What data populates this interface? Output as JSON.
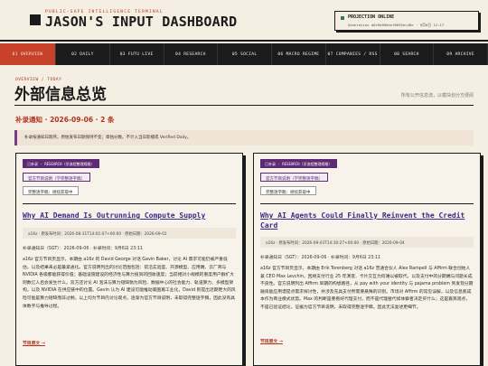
{
  "header": {
    "kicker": "PUBLIC-SAFE INTELLIGENCE TERMINAL",
    "title": "JASON'S INPUT DASHBOARD",
    "projection": {
      "title": "PROJECTION ONLINE",
      "meta": "Generation d0c9e000eef8695ec48e · 9月6日 12:17"
    }
  },
  "nav": [
    "01 OVERVIEW",
    "02 DAILY",
    "03 FUTU LIVE",
    "04 RESEARCH",
    "05 SOCIAL",
    "06 MACRO REGIME",
    "07 COMPANIES / RSS",
    "08 SEARCH",
    "09 ARCHIVE"
  ],
  "page": {
    "crumb": "OVERVIEW / TODAY",
    "title": "外部信息总览",
    "subtitle": "所有公开信息流，以模块划分方便阅"
  },
  "section": {
    "title": "补录通知 · 2026-09-06 · 2 条",
    "notice": "补录按通知日期序。原始发布日期保持不变；章独分数。不计入当日影播或 Verified Daily。"
  },
  "cards": [
    {
      "tag": "已补录 · RESEARCH（学流程整理规格）",
      "link": "官方节目说明（学完整逐字稿）",
      "kind": "完整逐字稿：继续获取中",
      "title": "Why AI Demand Is Outrunning Compute Supply",
      "meta": "a16z · 原发布时间：2026-08-31T14:01:07+00:00 · 原始日期：2026-09-01",
      "time": "补录通知日（SGT）：2026-09-06 · 补录时间：9月6日 23:11",
      "body": "a16z 官方节目页显示，本期由 a16z 的 David George 对话 Gavin Baker，讨论 AI 需求可能仍被严重低估，以及结果来必是最紧通化。官方说明列出的讨论范围包括：前沿实验室、开源模型、应用端、云厂商与 NVIDIA 各级都能获得价值；基础设施建设的经济性与算力投资的回收速度；当前相对小规模的重度用户群扩大则数亿人后会发生什么。双方还讨论 AI 泡沫与算力短缺孰为风险、数据中心的社会能力、轨道算力、多模型架构，以及 NVIDIA 在供应链中的位置。Gavin 认为 AI 建设可能推动美国再工业化，David 则提出近期更大的风险可能是算力短缺而非过剩。以上均为节目内讨论观点，逐渐为官方节目说明，未取得完整逐字稿，因此没有具体数字与推导过程。",
      "more": "节目原文 →"
    },
    {
      "tag": "已补录 · RESEARCH（学流程整理规格）",
      "link": "官方节目说明（学完整逐字稿）",
      "kind": "完整逐字稿：继续获取中",
      "title": "Why AI Agents Could Finally Reinvent the Credit Card",
      "meta": "a16z · 原发布时间：2026-09-03T14:30:27+00:00 · 原始日期：2026-09-04",
      "time": "补录通知日（SGT）：2026-09-06 · 补录时间：9月6日 23:11",
      "body": "a16z 官方节目页显示，本期由 Erik Torenberg 对话 a16z 普通合伙人 Alex Rampell 与 Affirm 联合创始人兼 CEO Max Levchin，回顾支付行业 25 年演变、卡片交互为何难以被取代，以及支付中的分期端与问题长成不良性。官方说明列出 Affirm 早期的构想路径，从 pay with your identity 与 pajama problem 到发现分期融资能应用谱提点需求探讨性，并涉及充具支付所需要悬殊的识别。市场对 Affirm 的常见误解，以及信息底成本作为商业模式优势。Max 的判断是要看好代理支付，而不是代理替代如体察者决定买什么；这是嘉宾观点，不是已验证结论。证据为官方节目说明，未取得完整逐字稿，因此无法复述更细节。",
      "more": "节目原文 →"
    }
  ]
}
